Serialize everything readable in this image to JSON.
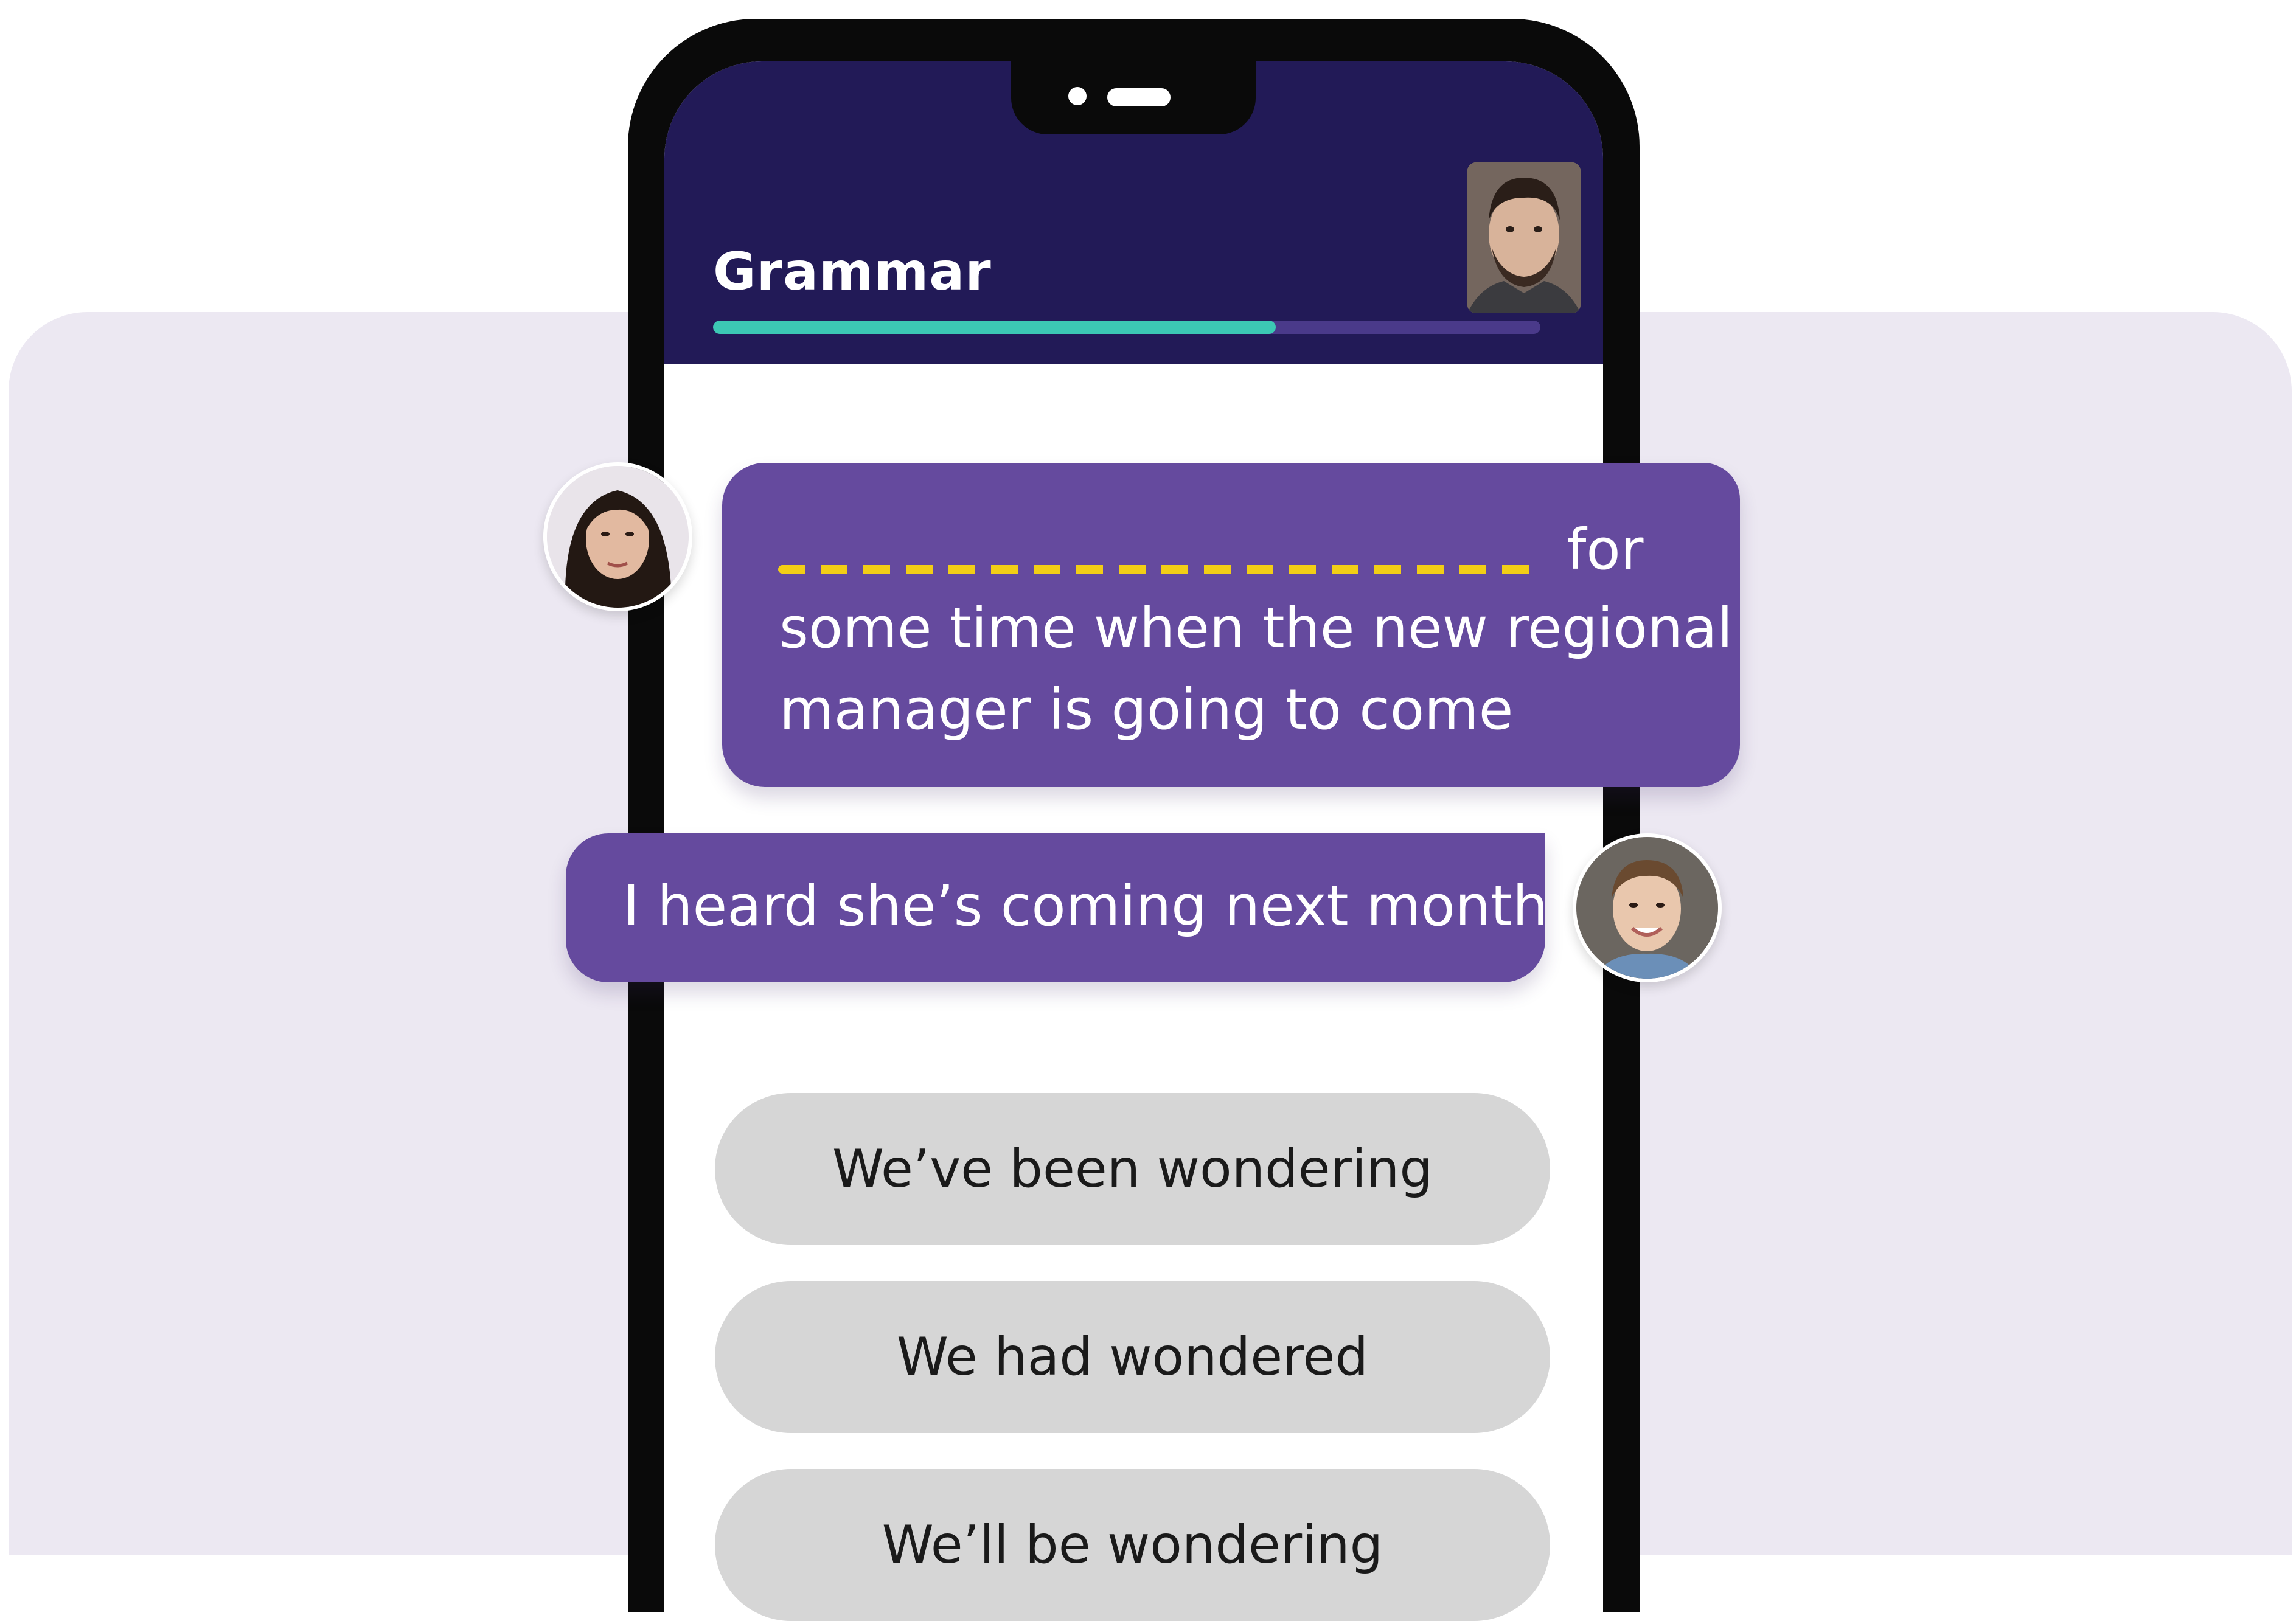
{
  "header": {
    "title": "Grammar",
    "progress_fraction": 0.68,
    "tutor_avatar": "man-portrait-avatar"
  },
  "conversation": {
    "question_bubble": {
      "avatar": "woman-portrait-avatar",
      "line1_after_blank": "for",
      "line2": "some time when the new regional",
      "line3": "manager is going to come"
    },
    "answer_bubble": {
      "avatar": "young-man-portrait-avatar",
      "text": "I heard she’s coming next month"
    }
  },
  "options": [
    {
      "label": "We’ve been wondering"
    },
    {
      "label": "We had wondered"
    },
    {
      "label": "We’ll be wondering"
    }
  ],
  "colors": {
    "header_bg": "#221A57",
    "bubble_bg": "#654A9E",
    "progress_fill": "#3CC8B4",
    "blank_dash": "#F2CE16",
    "option_bg": "#D6D6D6",
    "panel_bg": "#ECE8F2"
  }
}
